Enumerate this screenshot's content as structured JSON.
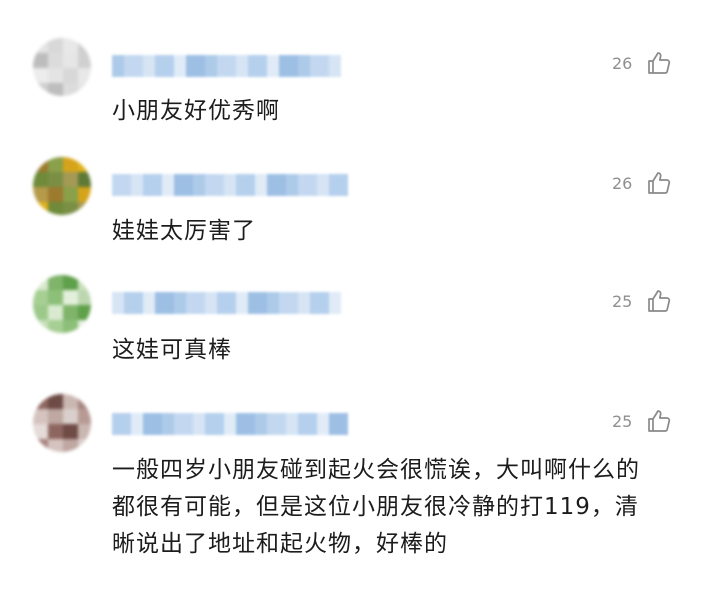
{
  "comments": [
    {
      "text": "小朋友好优秀啊",
      "likes": "26",
      "avatar_colors": [
        "#e4e4e4",
        "#d8d8d8",
        "#e8e8e8",
        "#cfcfcf",
        "#bdbdbd",
        "#dcdcdc",
        "#e6e6e6",
        "#d0d0d0",
        "#ececec"
      ]
    },
    {
      "text": "娃娃太厉害了",
      "likes": "26",
      "avatar_colors": [
        "#b59a4a",
        "#9c7a2e",
        "#8aa04a",
        "#d6a41a",
        "#e0b21c",
        "#6f8a3a",
        "#7a8f44",
        "#a49a55",
        "#5e7a36"
      ]
    },
    {
      "text": "这娃可真棒",
      "likes": "25",
      "avatar_colors": [
        "#bcd7b0",
        "#9cc98a",
        "#d9ead0",
        "#7fb46a",
        "#5fa04a",
        "#c8e0bb",
        "#a6cf94",
        "#8cbf78",
        "#e2efdb"
      ]
    },
    {
      "text": "一般四岁小朋友碰到起火会很慌诶，大叫啊什么的都很有可能，但是这位小朋友很冷静的打119，清晰说出了地址和起火物，好棒的",
      "likes": "25",
      "avatar_colors": [
        "#d9cfcc",
        "#b89a94",
        "#e5dbd8",
        "#8e6660",
        "#6f4b46",
        "#cbb7b2",
        "#a78580",
        "#d4c3bf",
        "#bfa7a2"
      ]
    }
  ],
  "username_color": "#9fc1e6"
}
